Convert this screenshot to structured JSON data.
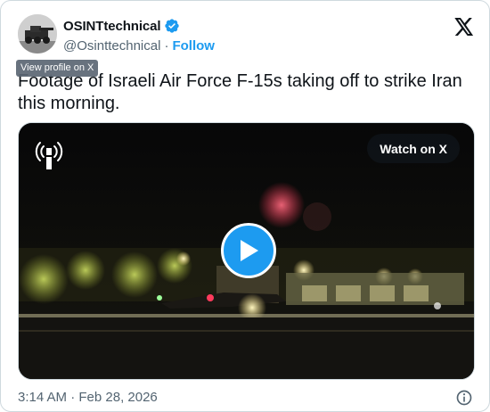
{
  "author": {
    "display_name": "OSINTtechnical",
    "handle": "@Osinttechnical",
    "separator": "·",
    "follow_label": "Follow",
    "tooltip": "View profile on X"
  },
  "tweet": {
    "text": "Footage of Israeli Air Force F-15s taking off to strike Iran this morning."
  },
  "media": {
    "watch_label": "Watch on X",
    "type": "video"
  },
  "footer": {
    "timestamp": "3:14 AM · Feb 28, 2026"
  },
  "icons": {
    "verified": "verified-badge-icon",
    "brand": "x-logo-icon",
    "play": "play-icon",
    "info": "info-icon",
    "channel": "broadcast-logo-icon"
  },
  "colors": {
    "accent": "#1d9bf0",
    "text": "#0f1419",
    "secondary": "#536471",
    "border": "#cfd9de"
  }
}
